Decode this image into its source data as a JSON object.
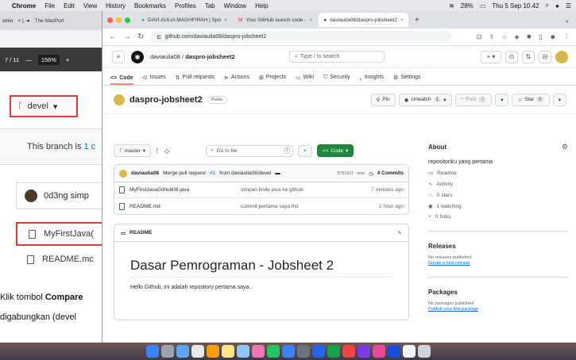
{
  "menubar": {
    "apple": "",
    "items": [
      "Chrome",
      "File",
      "Edit",
      "View",
      "History",
      "Bookmarks",
      "Profiles",
      "Tab",
      "Window",
      "Help"
    ],
    "battery": "28%",
    "clock": "Thu 5 Sep 10.42"
  },
  "bg_window": {
    "tabs": [
      "wnlo",
      "The MacPort"
    ],
    "pdf_page": "7 / 11",
    "pdf_zoom": "156%",
    "devel_label": "devel",
    "branch_note": "This branch is",
    "branch_note_count": "1 c",
    "commit_user": "0d3ng simp",
    "file1": "MyFirstJava(",
    "file2": "README.mc",
    "para1_prefix": "Klik tombol ",
    "para1_bold": "Compare",
    "para2": "digabungkan (devel"
  },
  "chrome": {
    "tabs": [
      {
        "label": "DAVI AULIA MAGHFIRAH | Spo"
      },
      {
        "label": "Your GitHub launch code -"
      },
      {
        "label": "daviaulia08/daspro-jobsheet2"
      }
    ],
    "url": "github.com/daviaulia08/daspro-jobsheet2"
  },
  "github": {
    "owner": "daviaulia08",
    "repo": "daspro-jobsheet2",
    "search_placeholder": "Type / to search",
    "nav": [
      "Code",
      "Issues",
      "Pull requests",
      "Actions",
      "Projects",
      "Wiki",
      "Security",
      "Insights",
      "Settings"
    ],
    "visibility": "Public",
    "pin_label": "Pin",
    "unwatch_label": "Unwatch",
    "unwatch_count": "1",
    "fork_label": "Fork",
    "fork_count": "0",
    "star_label": "Star",
    "star_count": "0",
    "branch": "master",
    "go_to_file": "Go to file",
    "code_btn": "Code",
    "latest_commit": {
      "user": "daviaulia08",
      "message": "Merge pull request",
      "pr": "#1",
      "rest": "from daviaulia08/devel",
      "sha": "975151f · now",
      "commits": "4 Commits"
    },
    "files": [
      {
        "name": "MyFirstJavaGithub08.java",
        "message": "simpan kode java ke github",
        "age": "7 minutes ago"
      },
      {
        "name": "README.md",
        "message": "commit pertama saya lho",
        "age": "1 hour ago"
      }
    ],
    "readme": {
      "label": "README",
      "heading": "Dasar Pemrograman - Jobsheet 2",
      "body": "Hello Github, ini adalah repository pertama saya."
    },
    "about": {
      "title": "About",
      "description": "repositoriku yang pertama",
      "items": [
        "Readme",
        "Activity",
        "0 stars",
        "1 watching",
        "0 forks"
      ]
    },
    "releases": {
      "title": "Releases",
      "none": "No releases published",
      "link": "Create a new release"
    },
    "packages": {
      "title": "Packages",
      "none": "No packages published",
      "link": "Publish your first package"
    }
  },
  "colors": {
    "accent_green": "#1f883d",
    "link_blue": "#0969da",
    "highlight_red": "#d93c3c"
  }
}
